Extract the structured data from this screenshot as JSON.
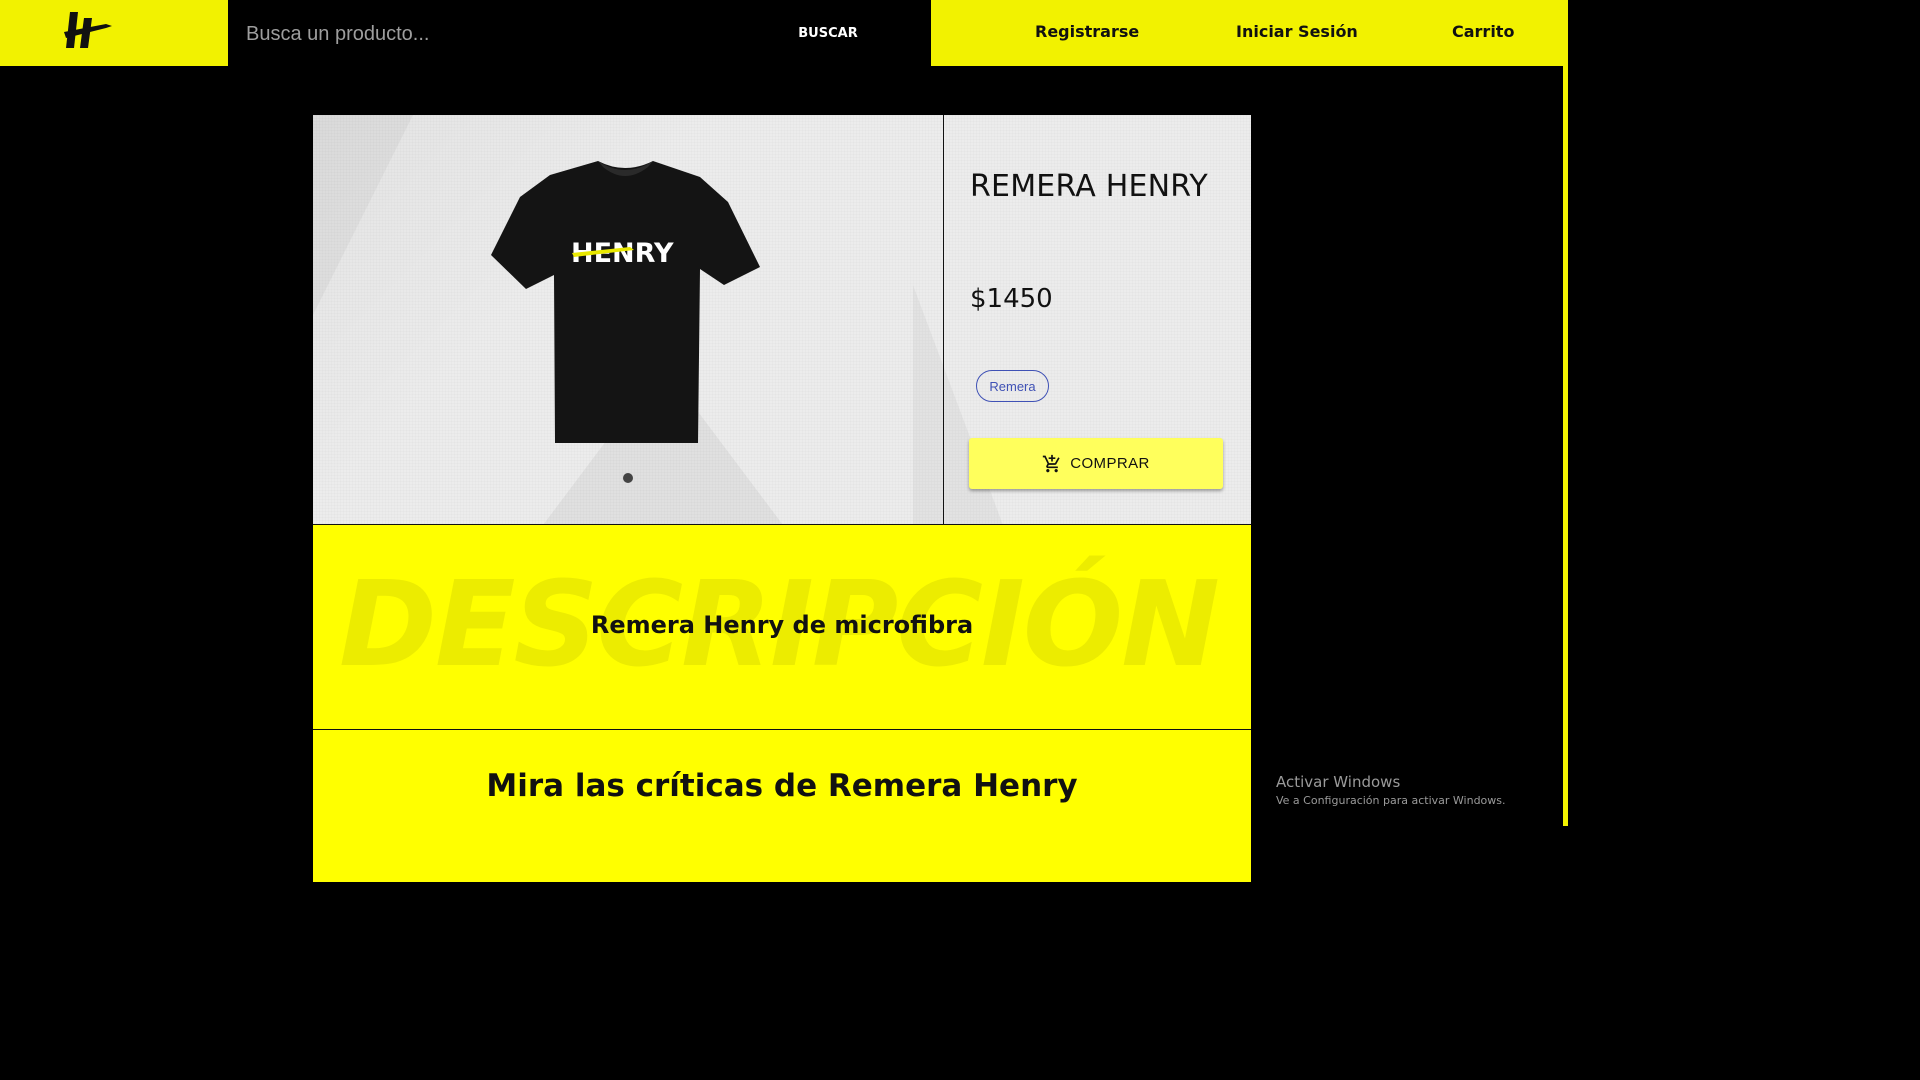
{
  "header": {
    "logo_alt": "Henry logo",
    "search": {
      "placeholder": "Busca un producto...",
      "value": ""
    },
    "search_button": "BUSCAR",
    "nav": {
      "register": "Registrarse",
      "login": "Iniciar Sesión",
      "cart": "Carrito"
    }
  },
  "product": {
    "title": "REMERA HENRY",
    "price": "$1450",
    "category_chip": "Remera",
    "buy_button": "COMPRAR",
    "image_text": "HENRY",
    "carousel": {
      "slides": 1,
      "active": 0
    }
  },
  "description": {
    "watermark": "DESCRIPCIÓN",
    "text": "Remera Henry de microfibra"
  },
  "reviews": {
    "title": "Mira las críticas de Remera Henry"
  },
  "system": {
    "activate_title": "Activar Windows",
    "activate_subtitle": "Ve a Configuración para activar Windows."
  },
  "colors": {
    "brand_yellow": "#f2f200",
    "section_yellow": "#ffff00",
    "button_yellow": "#ffff5c",
    "chip_blue": "#3f51b5",
    "background": "#000000"
  }
}
